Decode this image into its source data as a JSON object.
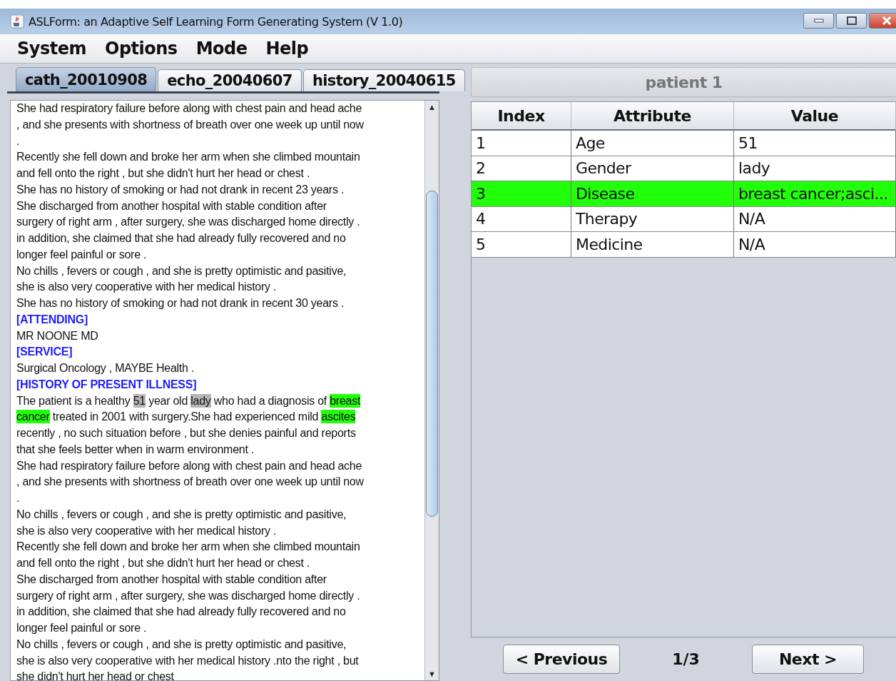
{
  "window": {
    "title": "ASLForm: an Adaptive Self Learning Form Generating System (V 1.0)"
  },
  "menu": [
    "System",
    "Options",
    "Mode",
    "Help"
  ],
  "tabs": [
    {
      "label": "cath_20010908",
      "selected": true
    },
    {
      "label": "echo_20040607",
      "selected": false
    },
    {
      "label": "history_20040615",
      "selected": false
    }
  ],
  "document": [
    {
      "kind": "text",
      "parts": [
        {
          "text": "She had respiratory failure before along with chest pain and head ache"
        }
      ]
    },
    {
      "kind": "text",
      "parts": [
        {
          "text": ", and she presents with shortness of breath over one week up until now"
        }
      ]
    },
    {
      "kind": "text",
      "parts": [
        {
          "text": "."
        }
      ]
    },
    {
      "kind": "text",
      "parts": [
        {
          "text": "Recently she fell down and broke her arm when she climbed mountain"
        }
      ]
    },
    {
      "kind": "text",
      "parts": [
        {
          "text": "and fell onto the right , but she didn't hurt her head or chest ."
        }
      ]
    },
    {
      "kind": "text",
      "parts": [
        {
          "text": "She has no history of smoking or had not drank in recent 23 years ."
        }
      ]
    },
    {
      "kind": "text",
      "parts": [
        {
          "text": "She discharged from another hospital with stable condition after"
        }
      ]
    },
    {
      "kind": "text",
      "parts": [
        {
          "text": "surgery of right arm , after surgery, she was discharged home directly ."
        }
      ]
    },
    {
      "kind": "text",
      "parts": [
        {
          "text": "in addition, she claimed that she had already fully recovered and no"
        }
      ]
    },
    {
      "kind": "text",
      "parts": [
        {
          "text": "longer feel painful or sore ."
        }
      ]
    },
    {
      "kind": "text",
      "parts": [
        {
          "text": "No chills , fevers or cough , and she is pretty optimistic and pasitive,"
        }
      ]
    },
    {
      "kind": "text",
      "parts": [
        {
          "text": "she is also very cooperative with her medical history ."
        }
      ]
    },
    {
      "kind": "text",
      "parts": [
        {
          "text": "She has no history of smoking or had not drank in recent 30 years ."
        }
      ]
    },
    {
      "kind": "heading",
      "parts": [
        {
          "text": "[ATTENDING]"
        }
      ]
    },
    {
      "kind": "text",
      "parts": [
        {
          "text": "MR NOONE MD"
        }
      ]
    },
    {
      "kind": "heading",
      "parts": [
        {
          "text": "[SERVICE]"
        }
      ]
    },
    {
      "kind": "text",
      "parts": [
        {
          "text": "Surgical Oncology , MAYBE Health ."
        }
      ]
    },
    {
      "kind": "heading",
      "parts": [
        {
          "text": "[HISTORY OF PRESENT ILLNESS]"
        }
      ]
    },
    {
      "kind": "text",
      "parts": [
        {
          "text": "The patient is a healthy "
        },
        {
          "text": "51",
          "color": "#b5b5b5"
        },
        {
          "text": " year old "
        },
        {
          "text": "lady",
          "color": "#b5b5b5"
        },
        {
          "text": " who had a diagnosis of "
        },
        {
          "text": "breast",
          "color": "#22ff0a"
        }
      ]
    },
    {
      "kind": "text",
      "parts": [
        {
          "text": "cancer",
          "color": "#22ff0a"
        },
        {
          "text": " treated in 2001 with surgery.She had experienced mild "
        },
        {
          "text": "ascites",
          "color": "#22ff0a"
        }
      ]
    },
    {
      "kind": "text",
      "parts": [
        {
          "text": "recently , no such situation before , but she denies painful and reports"
        }
      ]
    },
    {
      "kind": "text",
      "parts": [
        {
          "text": "that she feels better when in warm environment ."
        }
      ]
    },
    {
      "kind": "text",
      "parts": [
        {
          "text": "She had respiratory failure before along with chest pain and head ache"
        }
      ]
    },
    {
      "kind": "text",
      "parts": [
        {
          "text": ", and she presents with shortness of breath over one week up until now"
        }
      ]
    },
    {
      "kind": "text",
      "parts": [
        {
          "text": "."
        }
      ]
    },
    {
      "kind": "text",
      "parts": [
        {
          "text": "No chills , fevers or cough , and she is pretty optimistic and pasitive,"
        }
      ]
    },
    {
      "kind": "text",
      "parts": [
        {
          "text": "she is also very cooperative with her medical history ."
        }
      ]
    },
    {
      "kind": "text",
      "parts": [
        {
          "text": "Recently she fell down and broke her arm when she climbed mountain"
        }
      ]
    },
    {
      "kind": "text",
      "parts": [
        {
          "text": "and fell onto the right , but she didn't hurt her head or chest ."
        }
      ]
    },
    {
      "kind": "text",
      "parts": [
        {
          "text": "She discharged from another hospital with stable condition after"
        }
      ]
    },
    {
      "kind": "text",
      "parts": [
        {
          "text": "surgery of right arm , after surgery, she was discharged home directly ."
        }
      ]
    },
    {
      "kind": "text",
      "parts": [
        {
          "text": "in addition, she claimed that she had already fully recovered and no"
        }
      ]
    },
    {
      "kind": "text",
      "parts": [
        {
          "text": "longer feel painful or sore ."
        }
      ]
    },
    {
      "kind": "text",
      "parts": [
        {
          "text": "No chills , fevers or cough , and she is pretty optimistic and pasitive,"
        }
      ]
    },
    {
      "kind": "text",
      "parts": [
        {
          "text": "she is also very cooperative with her medical history .nto the right , but"
        }
      ]
    },
    {
      "kind": "text",
      "parts": [
        {
          "text": "she didn't hurt her head or chest"
        }
      ]
    }
  ],
  "scroll_up": "▲",
  "scroll_down": "▼",
  "patient": {
    "title": "patient 1"
  },
  "table": {
    "columns": [
      "Index",
      "Attribute",
      "Value"
    ],
    "rows": [
      {
        "cells": [
          "1",
          "Age",
          "51"
        ],
        "selected": false
      },
      {
        "cells": [
          "2",
          "Gender",
          "lady"
        ],
        "selected": false
      },
      {
        "cells": [
          "3",
          "Disease",
          "breast cancer;asci..."
        ],
        "selected": true
      },
      {
        "cells": [
          "4",
          "Therapy",
          "N/A"
        ],
        "selected": false
      },
      {
        "cells": [
          "5",
          "Medicine",
          "N/A"
        ],
        "selected": false
      }
    ]
  },
  "pager": {
    "previous": "< Previous",
    "page": "1/3",
    "next": "Next >"
  }
}
